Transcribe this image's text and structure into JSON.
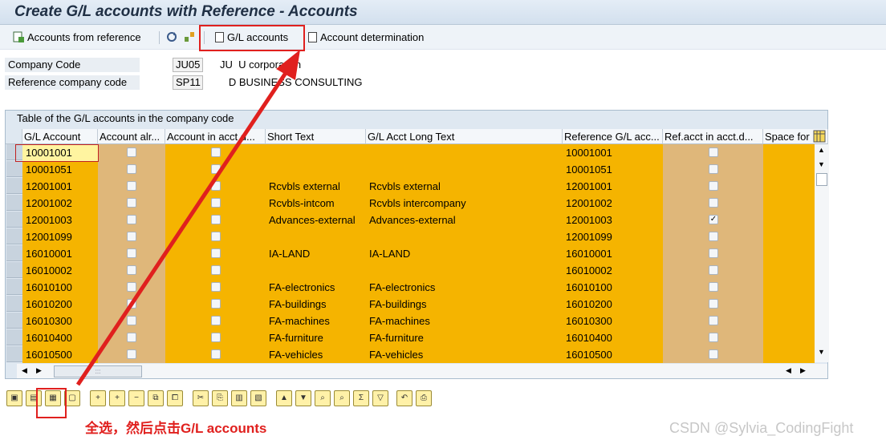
{
  "window": {
    "title": "Create G/L accounts with Reference - Accounts"
  },
  "toolbar": {
    "accounts_from_reference": "Accounts from reference",
    "gl_accounts": "G/L accounts",
    "account_determination": "Account determination"
  },
  "header_fields": {
    "company_code": {
      "label": "Company Code",
      "value": "JU05",
      "text": "JU  U corporation"
    },
    "reference_company_code": {
      "label": "Reference company code",
      "value": "SP11",
      "text": "   D BUSINESS CONSULTING"
    }
  },
  "grid": {
    "title": "Table of the G/L accounts in the company code",
    "columns": [
      "G/L Account",
      "Account alr...",
      "Account in acct d...",
      "Short Text",
      "G/L Acct Long Text",
      "Reference G/L acc...",
      "Ref.acct in acct.d...",
      "Space for"
    ],
    "rows": [
      {
        "account": "10001001",
        "already": false,
        "in_acct_det": false,
        "short": "",
        "long": "",
        "ref": "10001001",
        "ref_in_det": false
      },
      {
        "account": "10001051",
        "already": false,
        "in_acct_det": false,
        "short": "",
        "long": "",
        "ref": "10001051",
        "ref_in_det": false
      },
      {
        "account": "12001001",
        "already": false,
        "in_acct_det": false,
        "short": "Rcvbls external",
        "long": "Rcvbls external",
        "ref": "12001001",
        "ref_in_det": false
      },
      {
        "account": "12001002",
        "already": false,
        "in_acct_det": false,
        "short": "Rcvbls-intcom",
        "long": "Rcvbls intercompany",
        "ref": "12001002",
        "ref_in_det": false
      },
      {
        "account": "12001003",
        "already": false,
        "in_acct_det": false,
        "short": "Advances-external",
        "long": "Advances-external",
        "ref": "12001003",
        "ref_in_det": true
      },
      {
        "account": "12001099",
        "already": false,
        "in_acct_det": false,
        "short": "",
        "long": "",
        "ref": "12001099",
        "ref_in_det": false
      },
      {
        "account": "16010001",
        "already": false,
        "in_acct_det": false,
        "short": "IA-LAND",
        "long": "IA-LAND",
        "ref": "16010001",
        "ref_in_det": false
      },
      {
        "account": "16010002",
        "already": false,
        "in_acct_det": false,
        "short": "",
        "long": "",
        "ref": "16010002",
        "ref_in_det": false
      },
      {
        "account": "16010100",
        "already": false,
        "in_acct_det": false,
        "short": "FA-electronics",
        "long": "FA-electronics",
        "ref": "16010100",
        "ref_in_det": false
      },
      {
        "account": "16010200",
        "already": false,
        "in_acct_det": false,
        "short": "FA-buildings",
        "long": "FA-buildings",
        "ref": "16010200",
        "ref_in_det": false
      },
      {
        "account": "16010300",
        "already": false,
        "in_acct_det": false,
        "short": "FA-machines",
        "long": "FA-machines",
        "ref": "16010300",
        "ref_in_det": false
      },
      {
        "account": "16010400",
        "already": false,
        "in_acct_det": false,
        "short": "FA-furniture",
        "long": "FA-furniture",
        "ref": "16010400",
        "ref_in_det": false
      },
      {
        "account": "16010500",
        "already": false,
        "in_acct_det": false,
        "short": "FA-vehicles",
        "long": "FA-vehicles",
        "ref": "16010500",
        "ref_in_det": false
      }
    ]
  },
  "scroll": {
    "up": "▲",
    "down": "▼",
    "left": "◀",
    "right": "▶",
    "grip": ":::"
  },
  "annotation": "全选，然后点击G/L accounts",
  "watermark": "CSDN @Sylvia_CodingFight",
  "colors": {
    "row_orange": "#f5b400",
    "row_tan": "#dfb77a",
    "annotation_red": "#e0201e"
  }
}
